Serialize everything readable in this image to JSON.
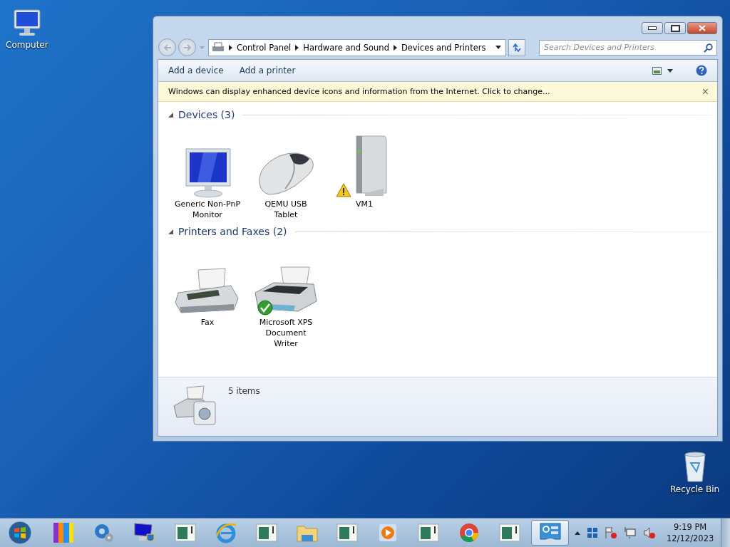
{
  "desktop_icons": [
    {
      "label": "Computer",
      "kind": "computer"
    },
    {
      "label": "Recycle Bin",
      "kind": "recycle"
    }
  ],
  "window": {
    "breadcrumb": [
      "Control Panel",
      "Hardware and Sound",
      "Devices and Printers"
    ],
    "search": {
      "placeholder": "Search Devices and Printers"
    },
    "toolbar": [
      "Add a device",
      "Add a printer"
    ],
    "infobar": {
      "text": "Windows can display enhanced device icons and information from the Internet. Click to change...",
      "close": "×"
    },
    "groups": [
      {
        "title": "Devices (3)",
        "expanded": true,
        "items": [
          {
            "name": "Generic Non-PnP Monitor",
            "kind": "monitor",
            "warning": false,
            "default": false
          },
          {
            "name": "QEMU USB Tablet",
            "kind": "mouse",
            "warning": false,
            "default": false
          },
          {
            "name": "VM1",
            "kind": "computer",
            "warning": true,
            "default": false
          }
        ]
      },
      {
        "title": "Printers and Faxes (2)",
        "expanded": true,
        "items": [
          {
            "name": "Fax",
            "kind": "fax",
            "warning": false,
            "default": false
          },
          {
            "name": "Microsoft XPS Document Writer",
            "kind": "printer",
            "warning": false,
            "default": true
          }
        ]
      }
    ],
    "details": {
      "text": "5 items"
    }
  },
  "taskbar": {
    "items": [
      {
        "kind": "bars",
        "active": false
      },
      {
        "kind": "gear",
        "active": false
      },
      {
        "kind": "monitor",
        "active": false
      },
      {
        "kind": "app",
        "active": false
      },
      {
        "kind": "ie",
        "active": false
      },
      {
        "kind": "app",
        "active": false
      },
      {
        "kind": "folder",
        "active": false
      },
      {
        "kind": "app",
        "active": false
      },
      {
        "kind": "media",
        "active": false
      },
      {
        "kind": "app",
        "active": false
      },
      {
        "kind": "chrome",
        "active": false
      },
      {
        "kind": "app",
        "active": false
      },
      {
        "kind": "control",
        "active": true
      }
    ],
    "time": "9:19 PM",
    "date": "12/12/2023"
  }
}
